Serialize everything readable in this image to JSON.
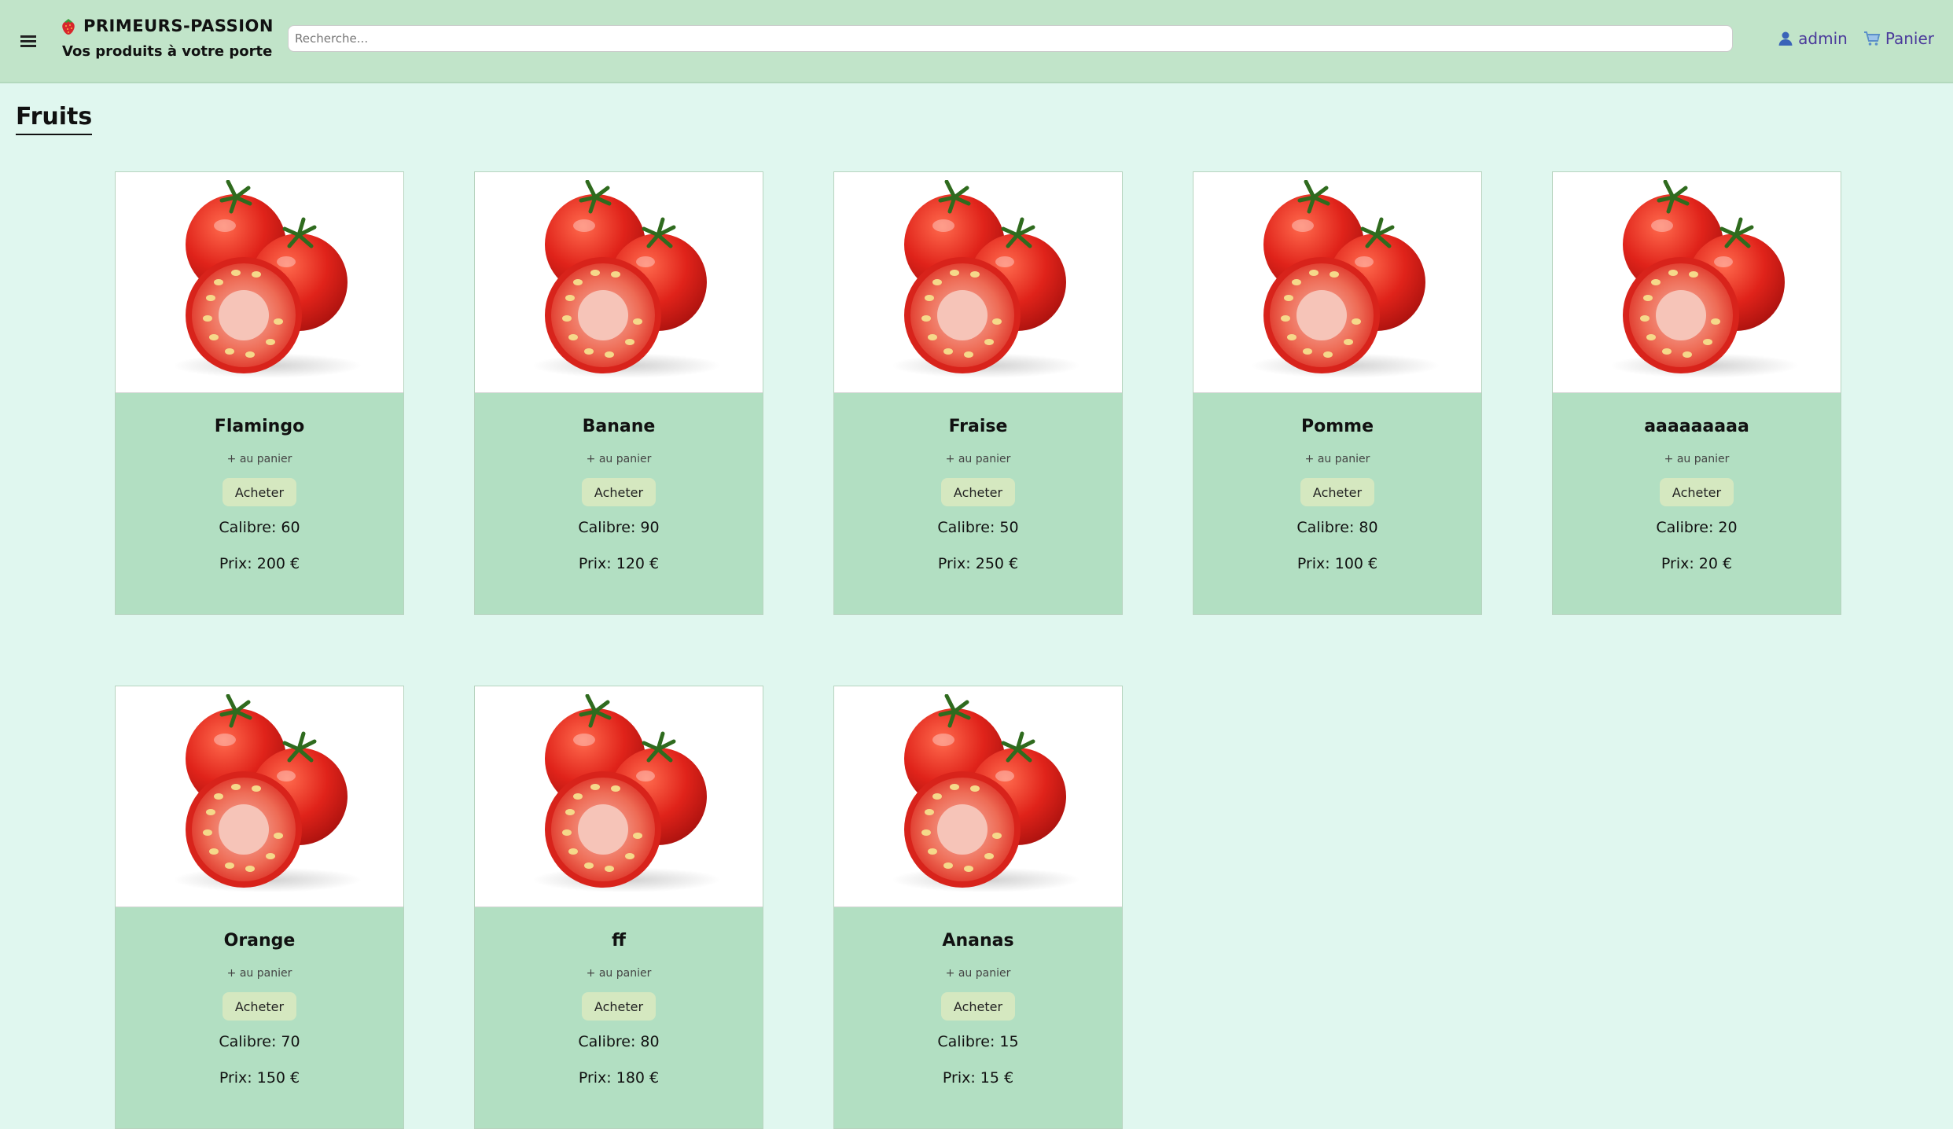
{
  "header": {
    "brand_title": "PRIMEURS-PASSION",
    "brand_tagline": "Vos produits à votre porte",
    "search_placeholder": "Recherche...",
    "user_label": "admin",
    "cart_label": "Panier",
    "accent_color": "#4b3a9b",
    "header_bg": "#c1e4c9"
  },
  "page": {
    "title": "Fruits",
    "page_bg": "#e0f7ef"
  },
  "products": [
    {
      "name": "Flamingo",
      "add_label": "+ au panier",
      "buy_label": "Acheter",
      "calibre": "Calibre: 60",
      "price": "Prix: 200 €",
      "image": "tomato-image"
    },
    {
      "name": "Banane",
      "add_label": "+ au panier",
      "buy_label": "Acheter",
      "calibre": "Calibre: 90",
      "price": "Prix: 120 €",
      "image": "tomato-image"
    },
    {
      "name": "Fraise",
      "add_label": "+ au panier",
      "buy_label": "Acheter",
      "calibre": "Calibre: 50",
      "price": "Prix: 250 €",
      "image": "tomato-image"
    },
    {
      "name": "Pomme",
      "add_label": "+ au panier",
      "buy_label": "Acheter",
      "calibre": "Calibre: 80",
      "price": "Prix: 100 €",
      "image": "tomato-image"
    },
    {
      "name": "aaaaaaaaa",
      "add_label": "+ au panier",
      "buy_label": "Acheter",
      "calibre": "Calibre: 20",
      "price": "Prix: 20 €",
      "image": "tomato-image"
    },
    {
      "name": "Orange",
      "add_label": "+ au panier",
      "buy_label": "Acheter",
      "calibre": "Calibre: 70",
      "price": "Prix: 150 €",
      "image": "tomato-image"
    },
    {
      "name": "ff",
      "add_label": "+ au panier",
      "buy_label": "Acheter",
      "calibre": "Calibre: 80",
      "price": "Prix: 180 €",
      "image": "tomato-image"
    },
    {
      "name": "Ananas",
      "add_label": "+ au panier",
      "buy_label": "Acheter",
      "calibre": "Calibre: 15",
      "price": "Prix: 15 €",
      "image": "tomato-image"
    }
  ]
}
